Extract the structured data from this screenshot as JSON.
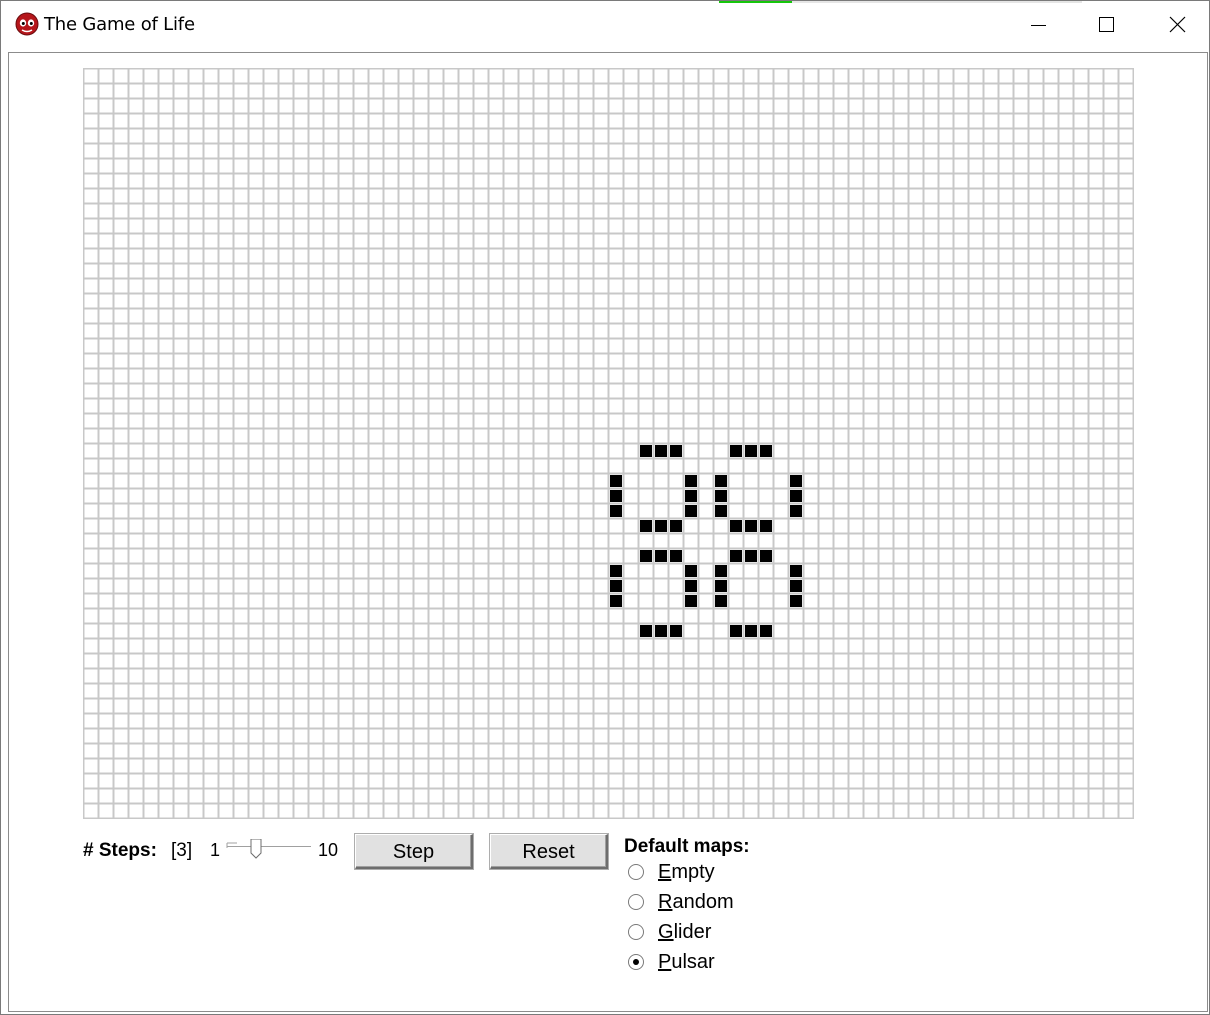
{
  "window": {
    "title": "The Game of Life",
    "controls": {
      "minimize": "minimize",
      "maximize": "maximize",
      "close": "close"
    }
  },
  "grid": {
    "columns": 70,
    "rows": 50,
    "live_cells": [
      [
        37,
        25
      ],
      [
        38,
        25
      ],
      [
        39,
        25
      ],
      [
        43,
        25
      ],
      [
        44,
        25
      ],
      [
        45,
        25
      ],
      [
        35,
        27
      ],
      [
        40,
        27
      ],
      [
        42,
        27
      ],
      [
        47,
        27
      ],
      [
        35,
        28
      ],
      [
        40,
        28
      ],
      [
        42,
        28
      ],
      [
        47,
        28
      ],
      [
        35,
        29
      ],
      [
        40,
        29
      ],
      [
        42,
        29
      ],
      [
        47,
        29
      ],
      [
        37,
        30
      ],
      [
        38,
        30
      ],
      [
        39,
        30
      ],
      [
        43,
        30
      ],
      [
        44,
        30
      ],
      [
        45,
        30
      ],
      [
        37,
        32
      ],
      [
        38,
        32
      ],
      [
        39,
        32
      ],
      [
        43,
        32
      ],
      [
        44,
        32
      ],
      [
        45,
        32
      ],
      [
        35,
        33
      ],
      [
        40,
        33
      ],
      [
        42,
        33
      ],
      [
        47,
        33
      ],
      [
        35,
        34
      ],
      [
        40,
        34
      ],
      [
        42,
        34
      ],
      [
        47,
        34
      ],
      [
        35,
        35
      ],
      [
        40,
        35
      ],
      [
        42,
        35
      ],
      [
        47,
        35
      ],
      [
        37,
        37
      ],
      [
        38,
        37
      ],
      [
        39,
        37
      ],
      [
        43,
        37
      ],
      [
        44,
        37
      ],
      [
        45,
        37
      ]
    ],
    "colors": {
      "line": "#c8c8c8",
      "dead": "#ffffff",
      "alive": "#000000"
    }
  },
  "controls": {
    "steps_label": "# Steps:",
    "steps_value": "[3]",
    "slider": {
      "min_label": "1",
      "max_label": "10",
      "min": 1,
      "max": 10,
      "value": 3
    },
    "step_button": "Step",
    "reset_button": "Reset"
  },
  "default_maps": {
    "title": "Default maps:",
    "options": [
      {
        "mnemonic": "E",
        "rest": "mpty",
        "selected": false
      },
      {
        "mnemonic": "R",
        "rest": "andom",
        "selected": false
      },
      {
        "mnemonic": "G",
        "rest": "lider",
        "selected": false
      },
      {
        "mnemonic": "P",
        "rest": "ulsar",
        "selected": true
      }
    ]
  }
}
